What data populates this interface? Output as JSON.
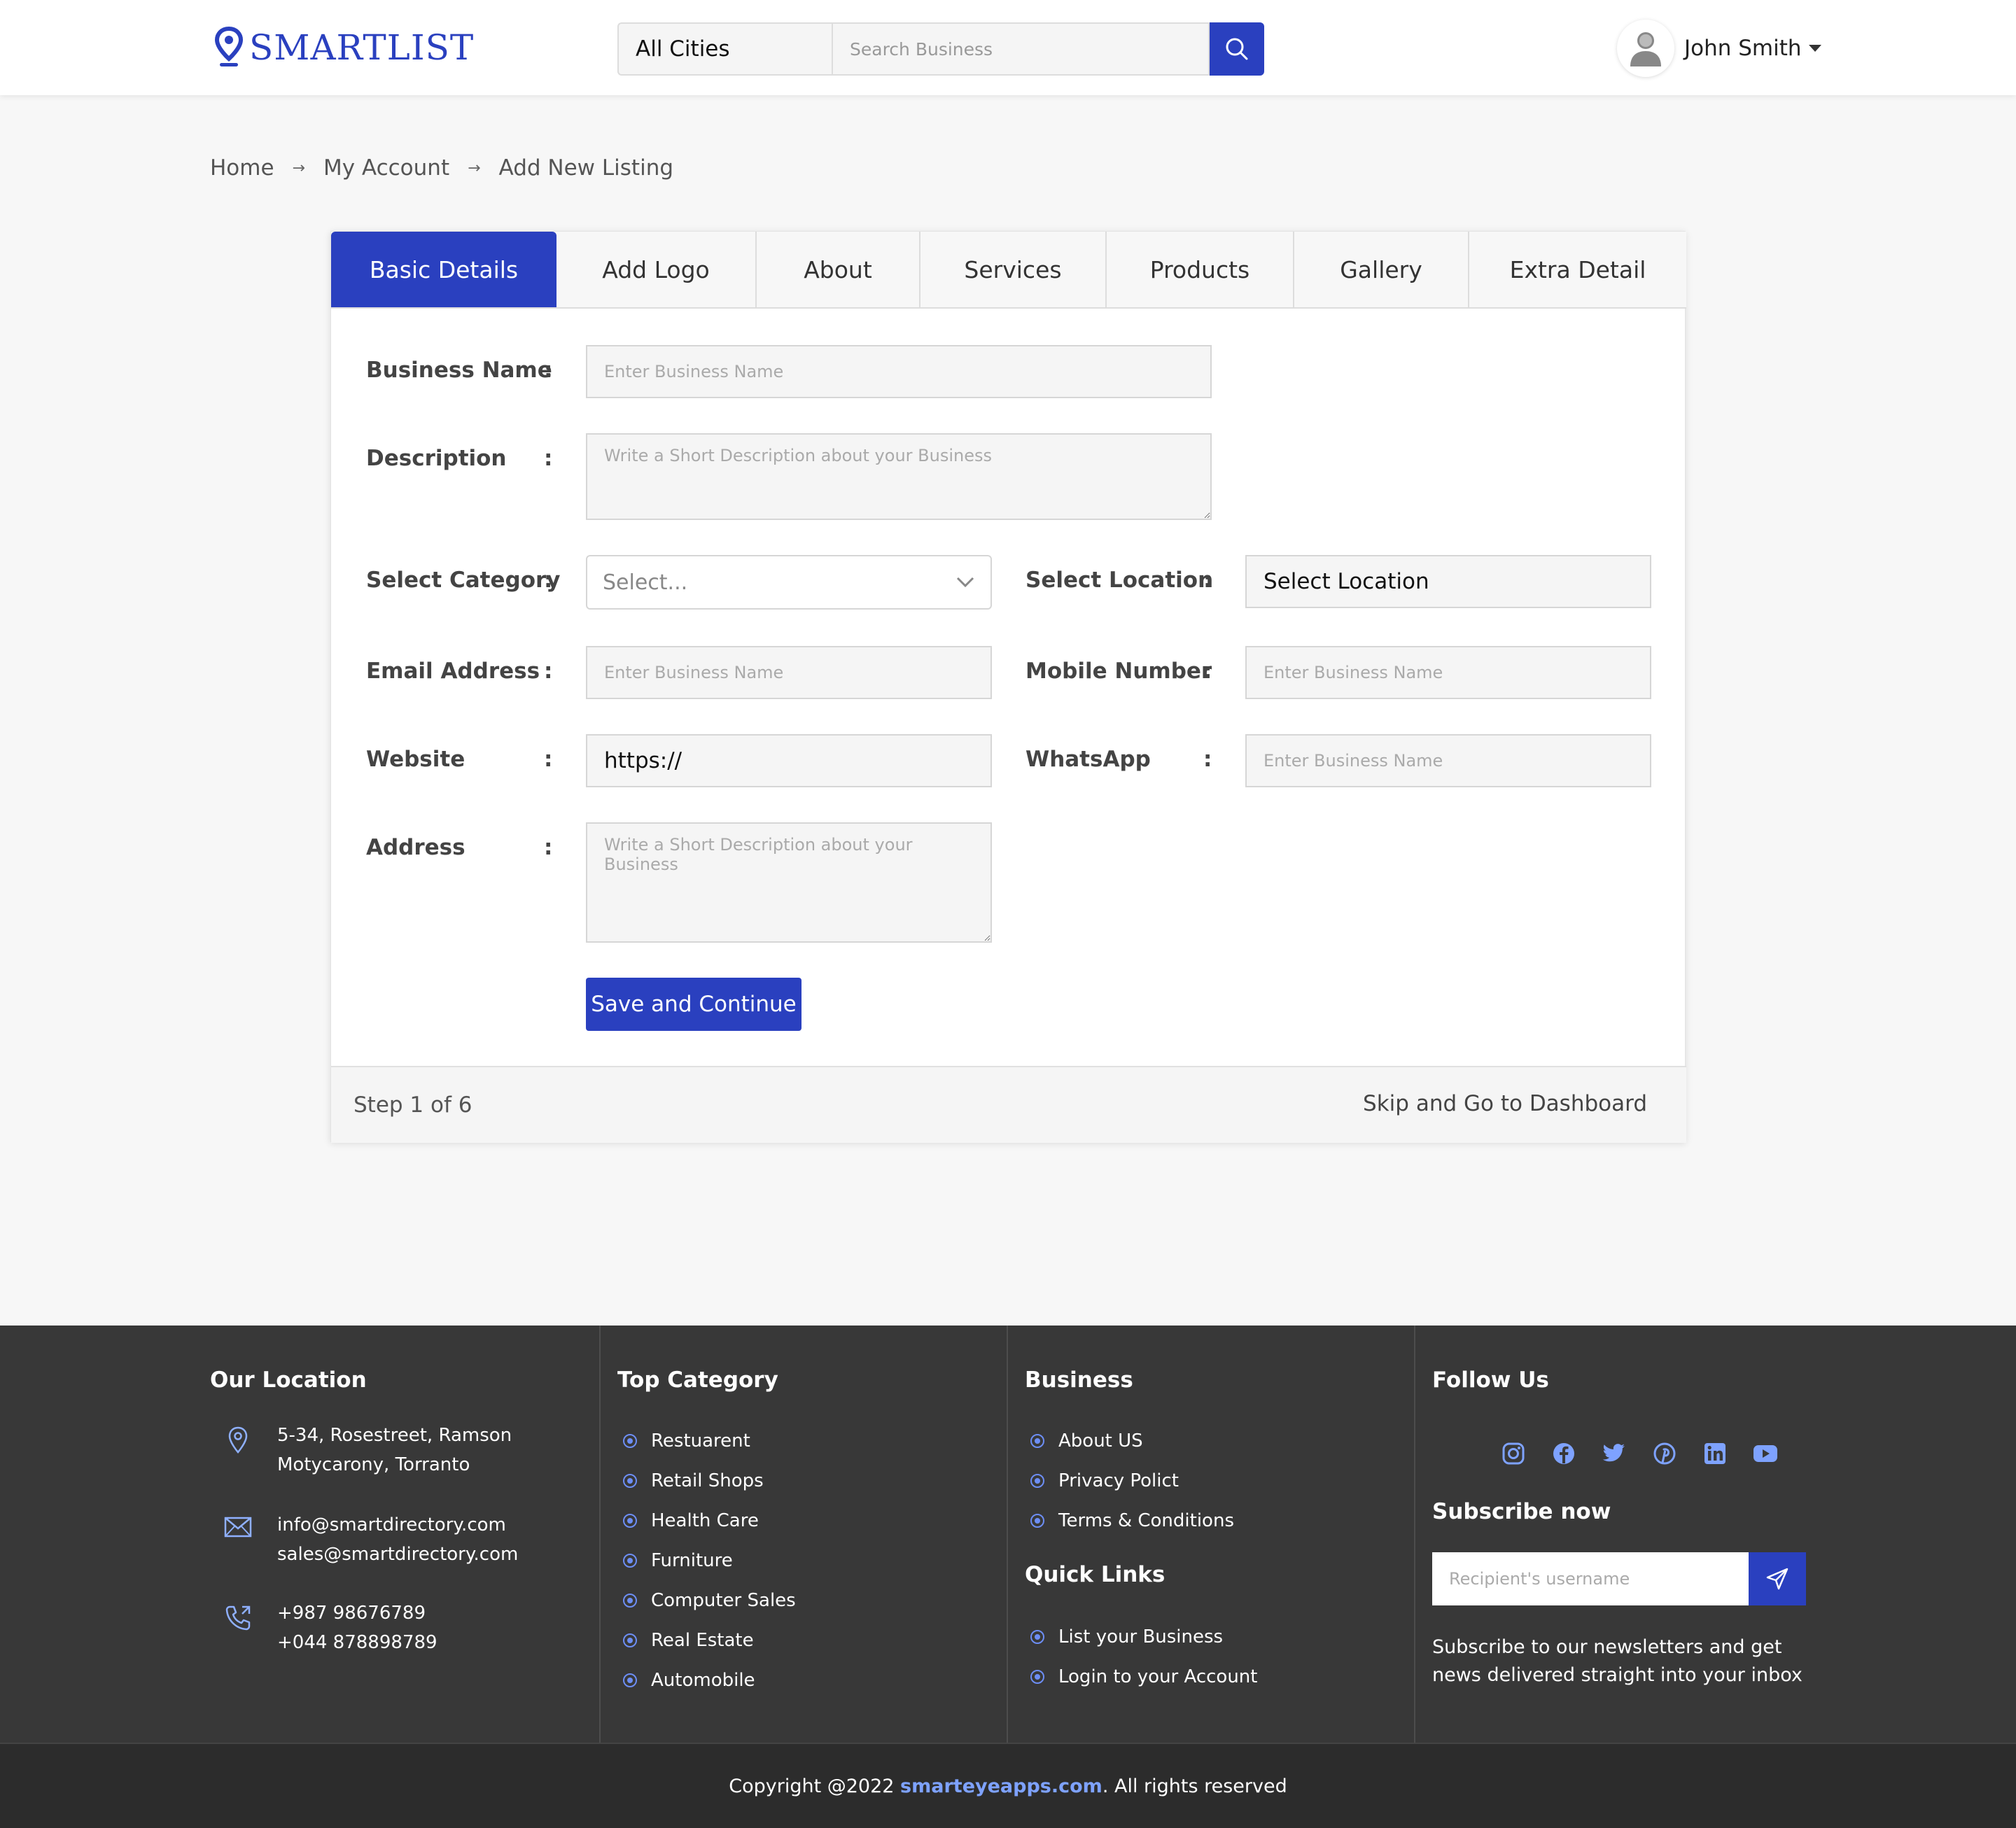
{
  "header": {
    "brand": "SMARTLIST",
    "city_select": "All Cities",
    "search_placeholder": "Search Business",
    "user_name": "John Smith"
  },
  "breadcrumb": {
    "home": "Home",
    "account": "My Account",
    "current": "Add New Listing"
  },
  "tabs": [
    {
      "label": "Basic Details",
      "active": true
    },
    {
      "label": "Add Logo",
      "active": false
    },
    {
      "label": "About",
      "active": false
    },
    {
      "label": "Services",
      "active": false
    },
    {
      "label": "Products",
      "active": false
    },
    {
      "label": "Gallery",
      "active": false
    },
    {
      "label": "Extra Detail",
      "active": false
    }
  ],
  "form": {
    "colon": ":",
    "business_name": {
      "label": "Business Name",
      "placeholder": "Enter Business Name"
    },
    "description": {
      "label": "Description",
      "placeholder": "Write a Short Description about your Business"
    },
    "category": {
      "label": "Select Category",
      "value": "Select..."
    },
    "location": {
      "label": "Select Location",
      "value": "Select Location"
    },
    "email": {
      "label": "Email Address",
      "placeholder": "Enter Business Name"
    },
    "mobile": {
      "label": "Mobile Number",
      "placeholder": "Enter Business Name"
    },
    "website": {
      "label": "Website",
      "value": "https://"
    },
    "whatsapp": {
      "label": "WhatsApp",
      "placeholder": "Enter Business Name"
    },
    "address": {
      "label": "Address",
      "placeholder": "Write a Short Description about your Business"
    },
    "save_label": "Save and Continue",
    "step": "Step 1 of 6",
    "skip": "Skip and Go to Dashboard"
  },
  "footer": {
    "location": {
      "heading": "Our Location",
      "address": [
        "5-34, Rosestreet, Ramson",
        "Motycarony, Torranto"
      ],
      "emails": [
        "info@smartdirectory.com",
        "sales@smartdirectory.com"
      ],
      "phones": [
        "+987 98676789",
        "+044 878898789"
      ]
    },
    "top_category": {
      "heading": "Top Category",
      "items": [
        "Restuarent",
        "Retail Shops",
        "Health Care",
        "Furniture",
        "Computer Sales",
        "Real Estate",
        "Automobile"
      ]
    },
    "business": {
      "heading": "Business",
      "items": [
        "About US",
        "Privacy Polict",
        "Terms & Conditions"
      ]
    },
    "quick_links": {
      "heading": "Quick Links",
      "items": [
        "List your Business",
        "Login to your Account"
      ]
    },
    "follow": {
      "heading": "Follow Us",
      "icons": [
        "instagram-icon",
        "facebook-icon",
        "twitter-icon",
        "pinterest-icon",
        "linkedin-icon",
        "youtube-icon"
      ]
    },
    "subscribe": {
      "heading": "Subscribe now",
      "placeholder": "Recipient's username",
      "text": "Subscribe to our newsletters and get news delivered straight into your inbox"
    },
    "copyright": {
      "prefix": "Copyright @2022 ",
      "link": "smarteyeapps.com",
      "suffix": ". All rights reserved"
    }
  },
  "colors": {
    "primary": "#2a40bf",
    "footer_bg": "#383838",
    "accent_light": "#6d8ef5"
  }
}
